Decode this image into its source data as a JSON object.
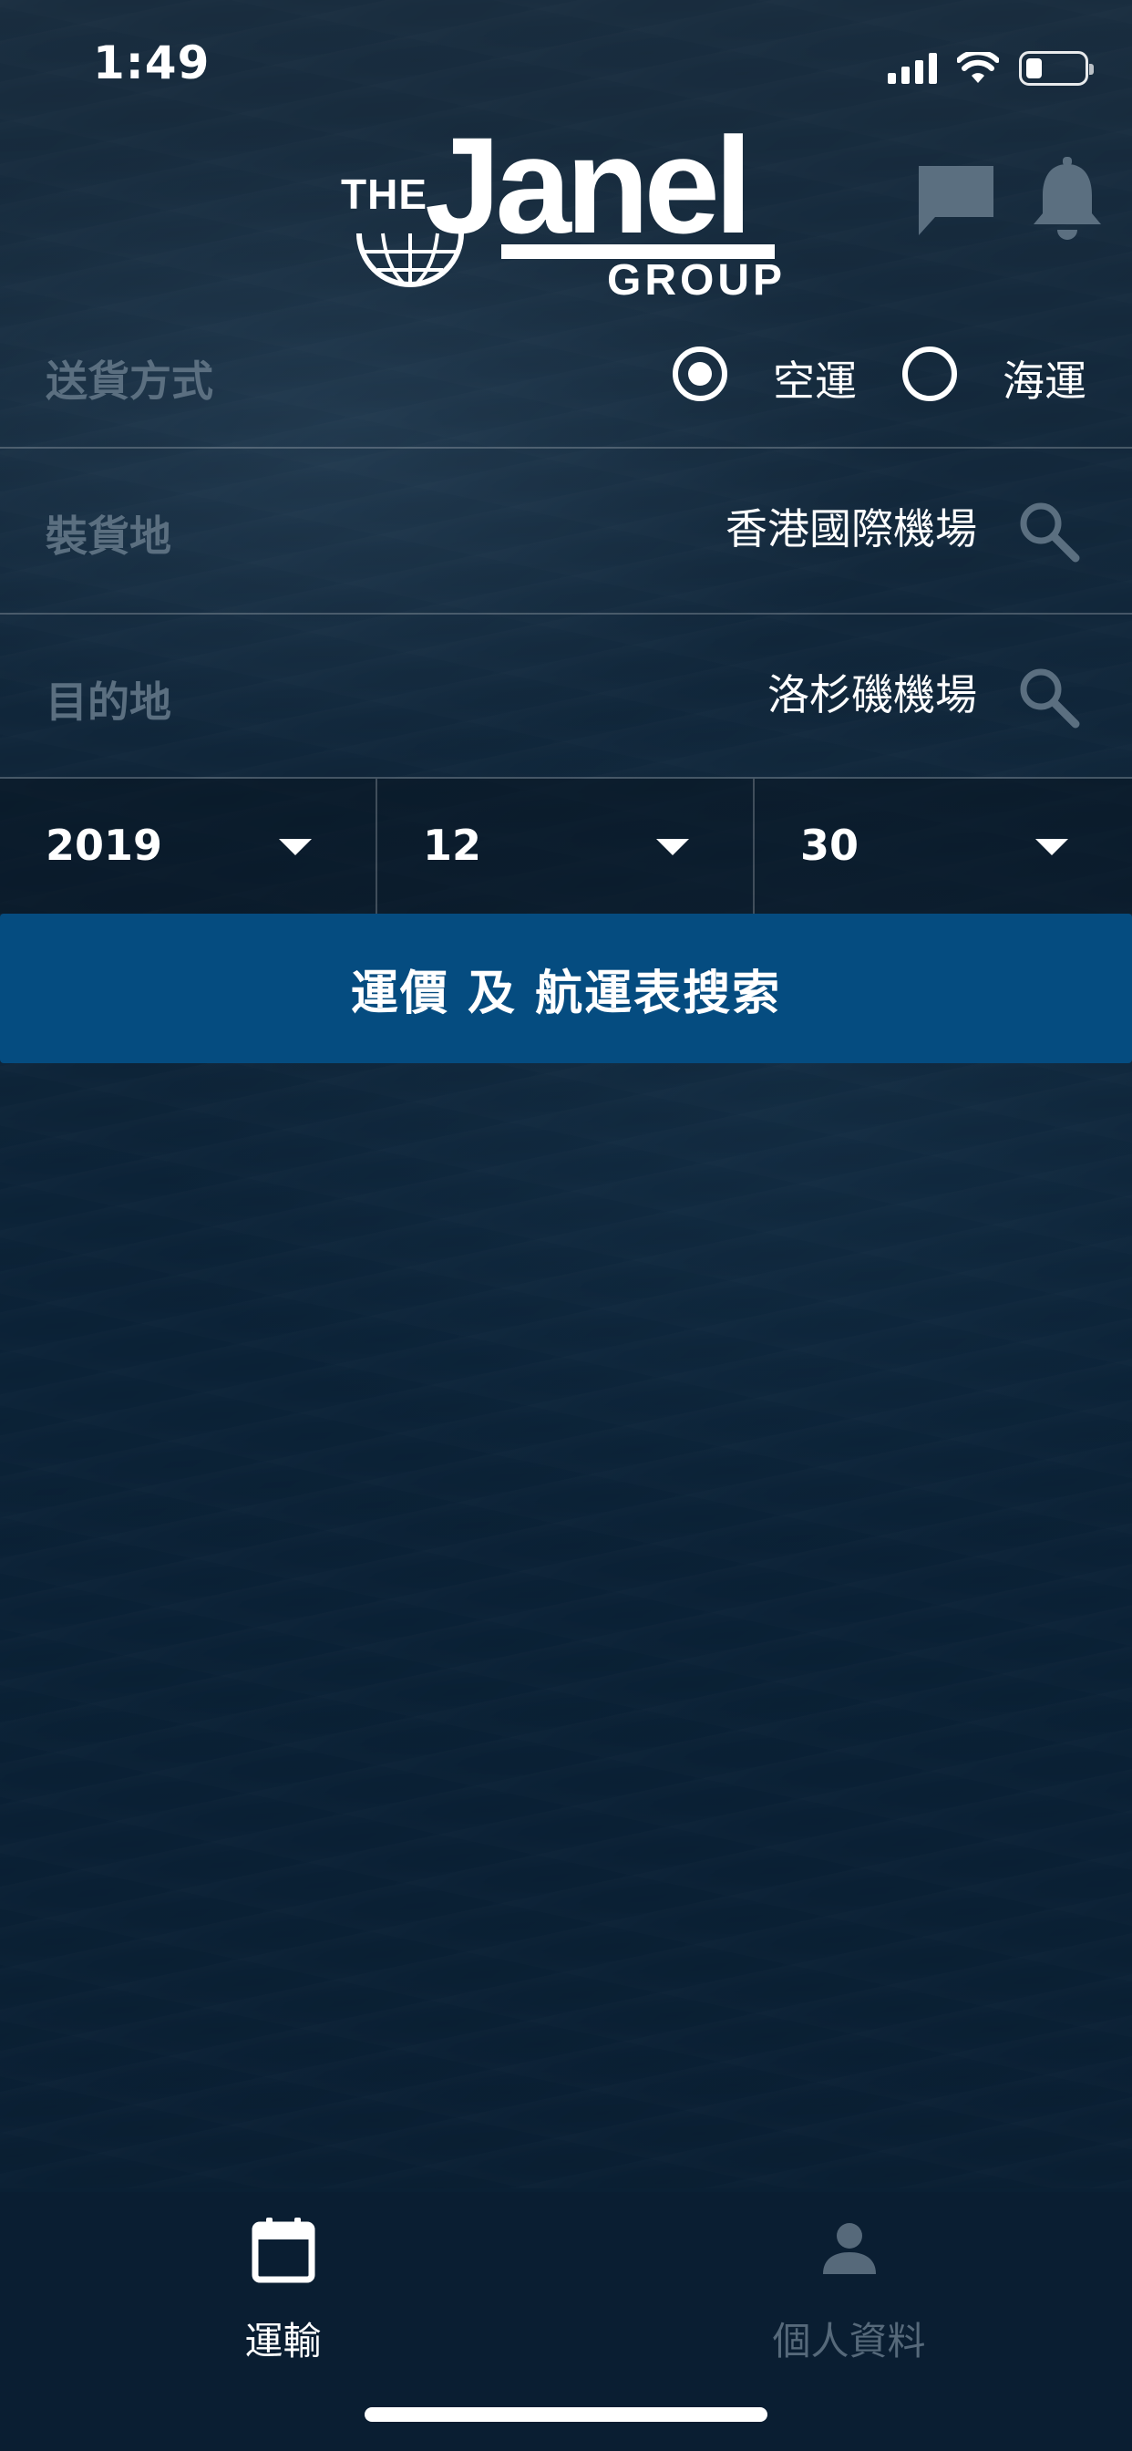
{
  "status_bar": {
    "time": "1:49",
    "icons": [
      "cellular-signal-icon",
      "wifi-icon",
      "battery-icon"
    ]
  },
  "header": {
    "logo": {
      "prefix": "THE",
      "word": "Janel",
      "suffix": "GROUP"
    },
    "icons": [
      "chat-icon",
      "bell-icon"
    ]
  },
  "form": {
    "delivery_method": {
      "label": "送貨方式",
      "options": [
        {
          "label": "空運",
          "selected": true
        },
        {
          "label": "海運",
          "selected": false
        }
      ]
    },
    "origin": {
      "label": "裝貨地",
      "value": "香港國際機場"
    },
    "destination": {
      "label": "目的地",
      "value": "洛杉磯機場"
    },
    "date": {
      "year": "2019",
      "month": "12",
      "day": "30"
    },
    "search_button": "運價 及 航運表搜索"
  },
  "tab_bar": {
    "tabs": [
      {
        "label": "運輸",
        "icon": "calendar-icon",
        "active": true
      },
      {
        "label": "個人資料",
        "icon": "person-icon",
        "active": false
      }
    ]
  },
  "colors": {
    "accent": "#054c80",
    "label_gray": "#5b6f80",
    "background": "#0e2233",
    "tab_inactive": "#56697a"
  }
}
